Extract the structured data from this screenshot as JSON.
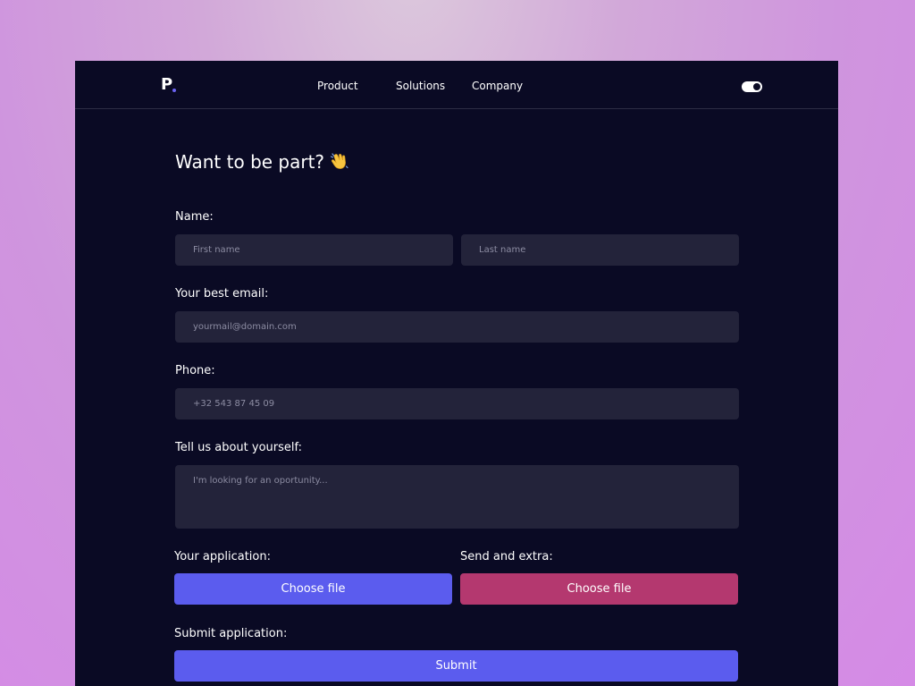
{
  "nav": {
    "logo": "P",
    "links": [
      "Product",
      "Solutions",
      "Company"
    ]
  },
  "form": {
    "title": "Want to be part?",
    "name_label": "Name:",
    "first_name_placeholder": "First name",
    "last_name_placeholder": "Last name",
    "email_label": "Your best email:",
    "email_placeholder": "yourmail@domain.com",
    "phone_label": "Phone:",
    "phone_placeholder": "+32 543 87 45 09",
    "about_label": "Tell us about yourself:",
    "about_placeholder": "I'm looking for an oportunity...",
    "application_label": "Your application:",
    "application_button": "Choose file",
    "extra_label": "Send and extra:",
    "extra_button": "Choose file",
    "submit_label": "Submit application:",
    "submit_button": "Submit"
  },
  "colors": {
    "background": "#0a0a24",
    "field": "#23233a",
    "primary": "#5b5cee",
    "secondary": "#b4386f",
    "logo_dot": "#6b63f2"
  },
  "icons": {
    "title_emoji": "waving-hand-icon",
    "theme_toggle": "toggle-switch-icon"
  }
}
